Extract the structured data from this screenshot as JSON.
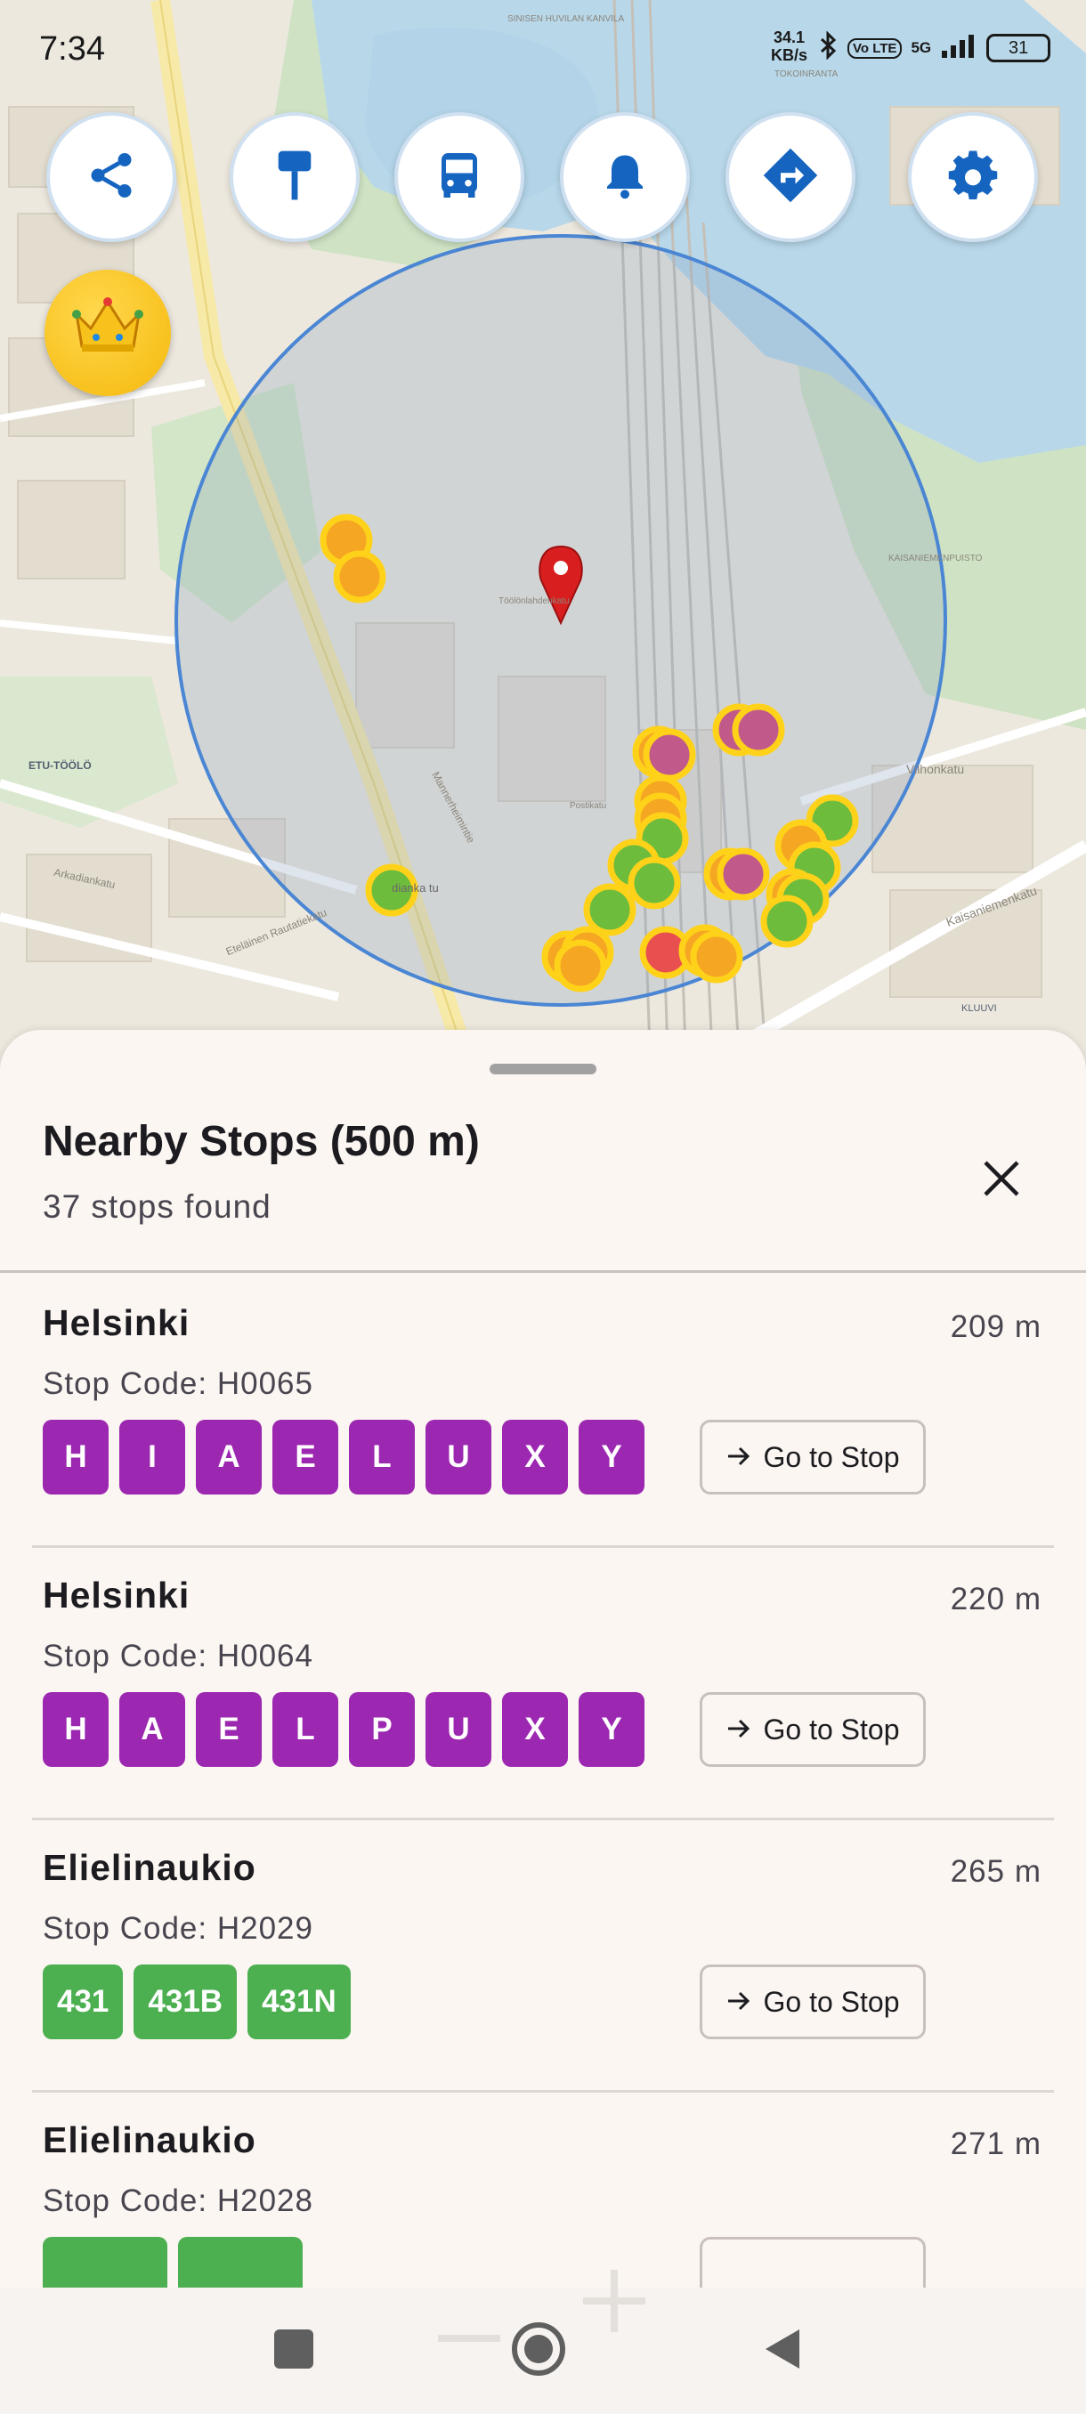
{
  "status_bar": {
    "time": "7:34",
    "net_speed_value": "34.1",
    "net_speed_unit": "KB/s",
    "volte_label": "Vo LTE",
    "network_label": "5G",
    "battery_level": "31"
  },
  "map": {
    "street_labels": [
      "SINISEN HUVILAN KANVILA",
      "TOKOINRANTA",
      "KAISANIEMENPUISTO",
      "ETU-TÖÖLÖ",
      "KLUUVI",
      "Mannerheimintie",
      "Vilhonkatu",
      "Kaisaniemenkatu",
      "Arkadiankatu",
      "Eteläinen Rautatiekatu",
      "Postikatu",
      "Töölönlahdenkatu",
      "dianka tu"
    ],
    "buttons": [
      {
        "name": "share-button",
        "icon": "share-icon"
      },
      {
        "name": "stop-sign-button",
        "icon": "signpost-icon"
      },
      {
        "name": "bus-button",
        "icon": "bus-icon"
      },
      {
        "name": "alerts-button",
        "icon": "bell-icon"
      },
      {
        "name": "directions-button",
        "icon": "directions-icon"
      },
      {
        "name": "settings-button",
        "icon": "gear-icon"
      }
    ],
    "premium_icon": "crown-icon",
    "radius_circle_color": "#4a86d4",
    "marker_colors": {
      "bus": "#6ebc3c",
      "tram": "#c15a8a",
      "train": "#f5a623",
      "metro": "#e85050",
      "outline": "#ffd21a"
    }
  },
  "sheet": {
    "title": "Nearby Stops (500 m)",
    "subtitle": "37 stops found",
    "go_label": "Go to Stop",
    "stops": [
      {
        "name": "Helsinki",
        "distance": "209 m",
        "code": "Stop Code: H0065",
        "routes": [
          "H",
          "I",
          "A",
          "E",
          "L",
          "U",
          "X",
          "Y"
        ],
        "color": "#9c27b0"
      },
      {
        "name": "Helsinki",
        "distance": "220 m",
        "code": "Stop Code: H0064",
        "routes": [
          "H",
          "A",
          "E",
          "L",
          "P",
          "U",
          "X",
          "Y"
        ],
        "color": "#9c27b0"
      },
      {
        "name": "Elielinaukio",
        "distance": "265 m",
        "code": "Stop Code: H2029",
        "routes": [
          "431",
          "431B",
          "431N"
        ],
        "color": "#4caf50"
      },
      {
        "name": "Elielinaukio",
        "distance": "271 m",
        "code": "Stop Code: H2028",
        "routes": [],
        "color": "#4caf50"
      }
    ]
  },
  "navbar": {
    "buttons": [
      "recents-button",
      "home-button",
      "back-button"
    ]
  }
}
